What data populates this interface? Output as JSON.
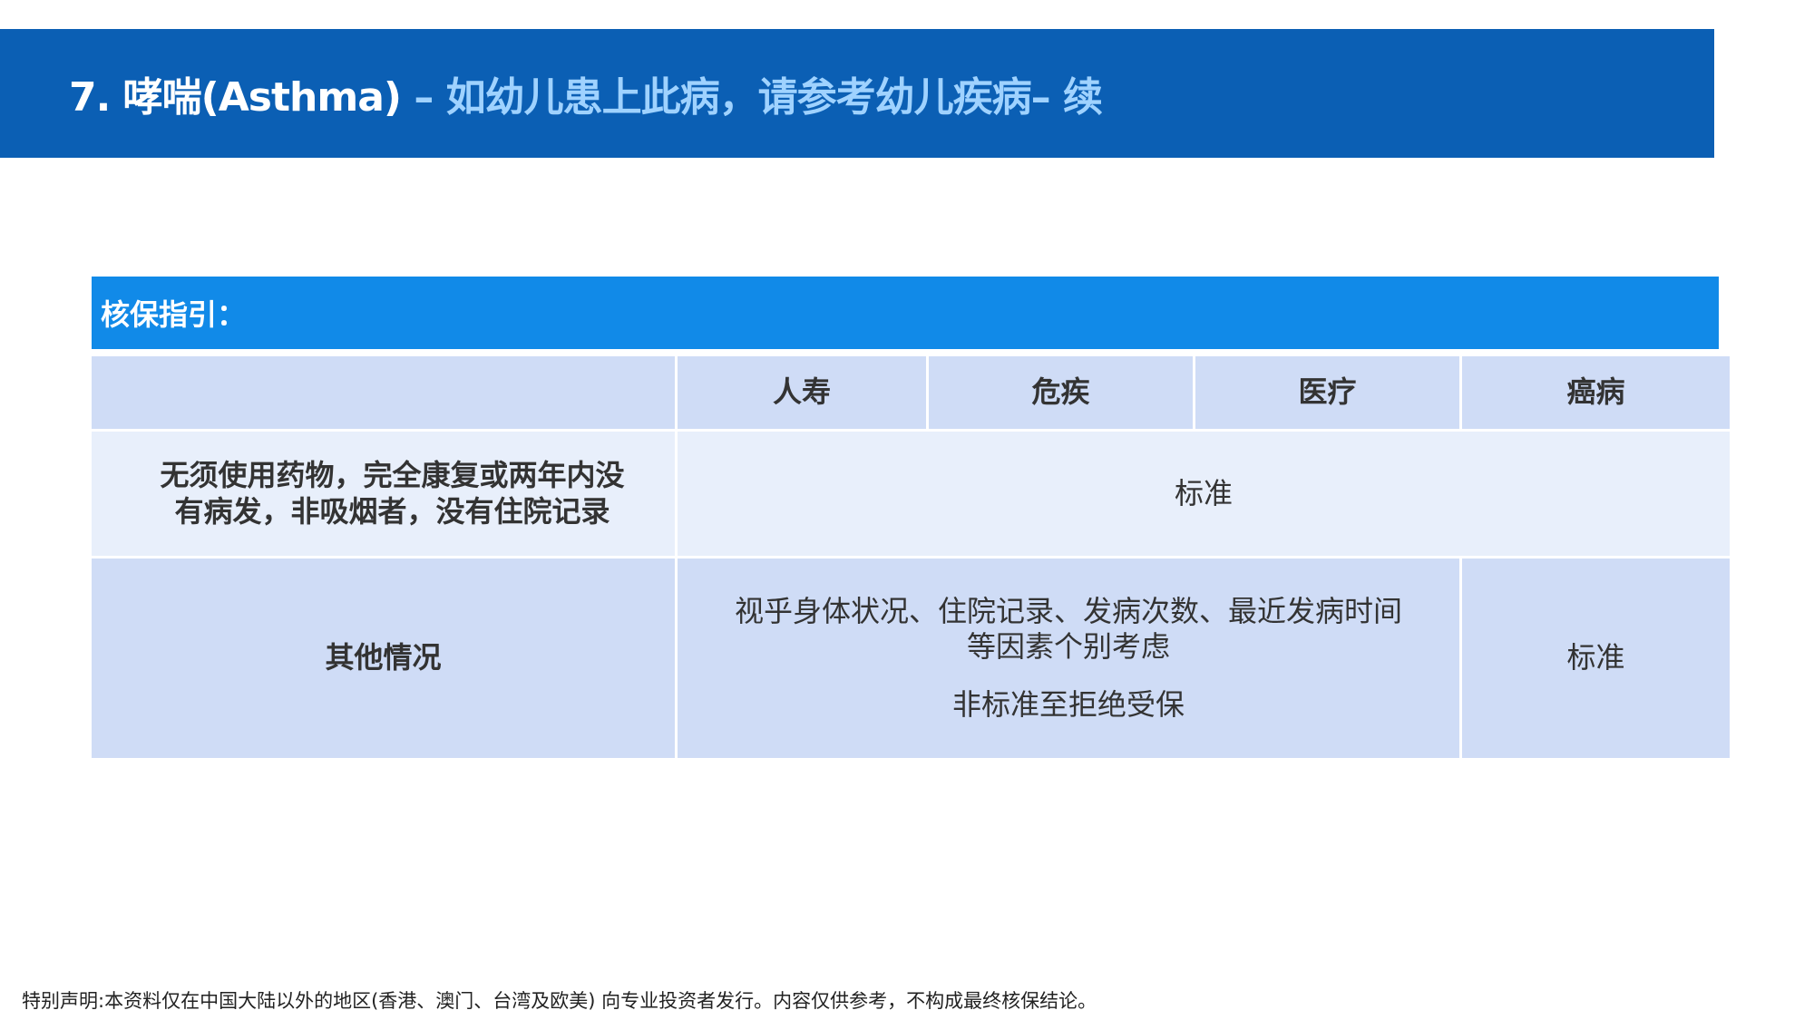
{
  "header": {
    "title_prefix": "7. 哮喘(Asthma)",
    "title_accent": " – 如幼儿患上此病，请参考幼儿疾病– 续"
  },
  "guide": {
    "title": "核保指引："
  },
  "table": {
    "columns": [
      "",
      "人寿",
      "危疾",
      "医疗",
      "癌病"
    ],
    "row1": {
      "label_line1": "无须使用药物，完全康复或两年内没",
      "label_line2": "有病发，非吸烟者，没有住院记录",
      "value": "标准"
    },
    "row2": {
      "label": "其他情况",
      "value_line1": "视乎身体状况、住院记录、发病次数、最近发病时间",
      "value_line2": "等因素个别考虑",
      "value_note": "非标准至拒绝受保",
      "cancer_value": "标准"
    }
  },
  "footer": {
    "disclaimer": "特别声明:本资料仅在中国大陆以外的地区(香港、澳门、台湾及欧美) 向专业投资者发行。内容仅供参考，不构成最终核保结论。"
  }
}
